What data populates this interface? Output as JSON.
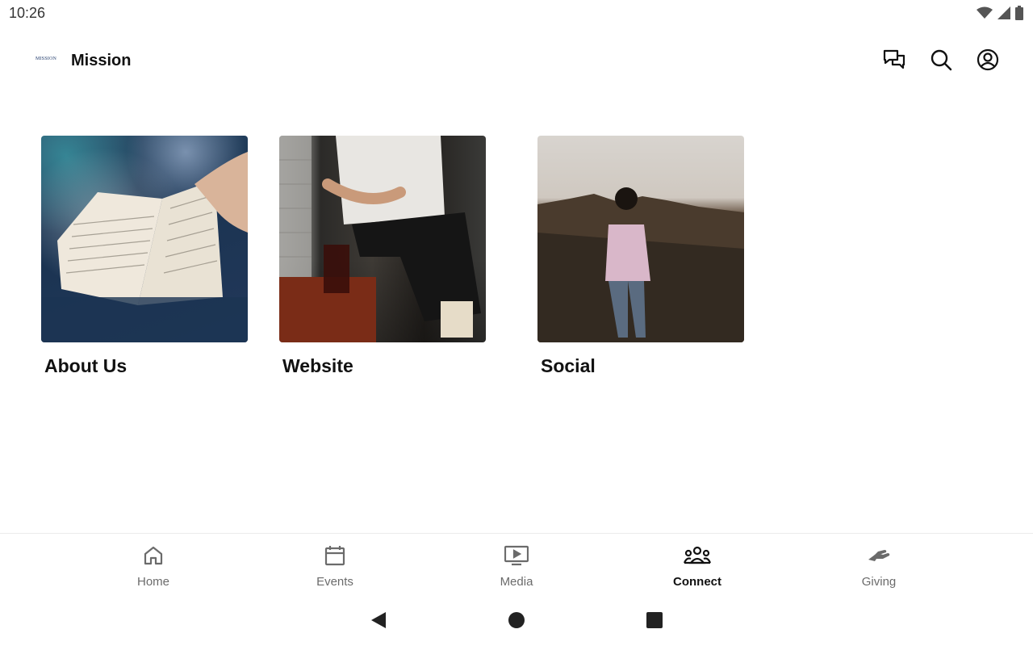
{
  "status_bar": {
    "time": "10:26",
    "icons": [
      "wifi-icon",
      "cell-signal-icon",
      "battery-icon"
    ]
  },
  "app_bar": {
    "logo_text": "MISSION",
    "title": "Mission",
    "actions": [
      {
        "name": "chat-icon"
      },
      {
        "name": "search-icon"
      },
      {
        "name": "account-icon"
      }
    ]
  },
  "tiles": [
    {
      "label": "About Us",
      "image": "open-bible-photo"
    },
    {
      "label": "Website",
      "image": "person-seated-with-drink-photo"
    },
    {
      "label": "Social",
      "image": "woman-on-mountain-at-sunset-photo"
    }
  ],
  "bottom_nav": {
    "items": [
      {
        "label": "Home",
        "icon": "home-icon",
        "active": false
      },
      {
        "label": "Events",
        "icon": "calendar-icon",
        "active": false
      },
      {
        "label": "Media",
        "icon": "media-play-icon",
        "active": false
      },
      {
        "label": "Connect",
        "icon": "people-group-icon",
        "active": true
      },
      {
        "label": "Giving",
        "icon": "giving-hand-icon",
        "active": false
      }
    ]
  },
  "colors": {
    "active": "#111111",
    "inactive": "#6b6b6b",
    "logo": "#1f3a6b"
  }
}
